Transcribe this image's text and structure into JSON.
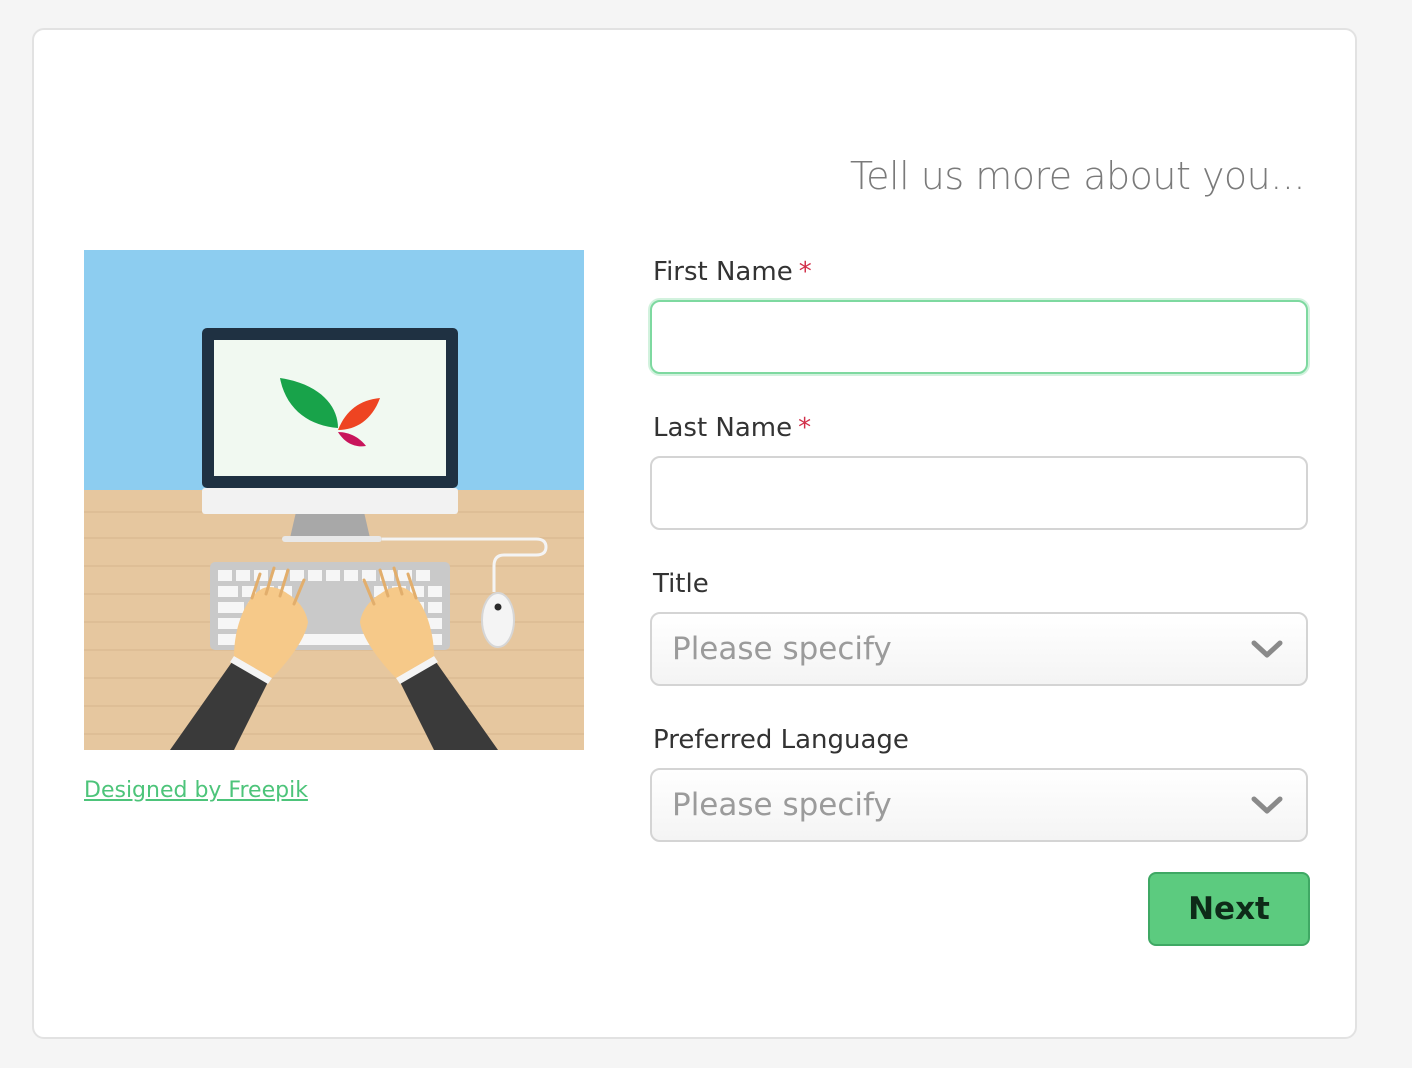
{
  "heading": "Tell us more about you...",
  "credit_link": "Designed by Freepik",
  "form": {
    "first_name": {
      "label": "First Name",
      "required_marker": "*",
      "value": ""
    },
    "last_name": {
      "label": "Last Name",
      "required_marker": "*",
      "value": ""
    },
    "title": {
      "label": "Title",
      "selected": "Please specify"
    },
    "preferred_language": {
      "label": "Preferred Language",
      "selected": "Please specify"
    },
    "next_button": "Next"
  },
  "colors": {
    "accent_green": "#5ccb7f",
    "required_red": "#d2304a",
    "link_green": "#4dc47a",
    "focus_border": "#7ed9a0"
  },
  "icons": {
    "select_arrow": "chevron-down-icon"
  }
}
